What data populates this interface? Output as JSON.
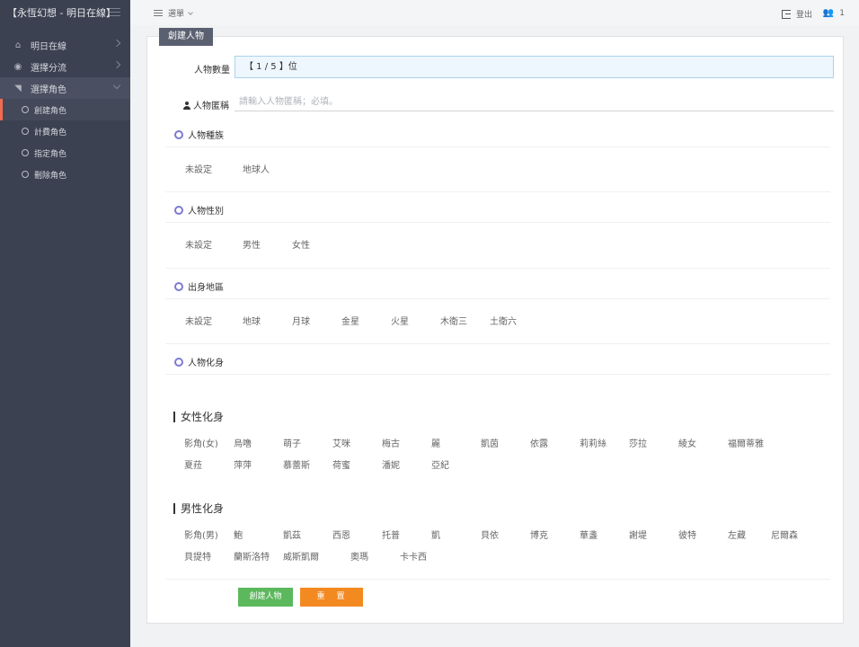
{
  "sidebar": {
    "brand": "【永恆幻想 - 明日在線】",
    "items": [
      {
        "label": "明日在線",
        "icon": "home-icon"
      },
      {
        "label": "選擇分流",
        "icon": "globe-icon"
      },
      {
        "label": "選擇角色",
        "icon": "triangle-icon"
      }
    ],
    "sub_items": [
      {
        "label": "創建角色"
      },
      {
        "label": "計費角色"
      },
      {
        "label": "指定角色"
      },
      {
        "label": "刪除角色"
      }
    ]
  },
  "topbar": {
    "menu_label": "選單",
    "logout_label": "登出",
    "users_count": "1"
  },
  "panel": {
    "tab": "創建人物",
    "quantity_label": "人物數量",
    "quantity_value": "【 1 / 5 】位",
    "name_label": "人物匿稱",
    "name_placeholder": "請輸入人物匿稱；必填。",
    "race": {
      "title": "人物種族",
      "options": [
        "未設定",
        "地球人"
      ]
    },
    "gender": {
      "title": "人物性別",
      "options": [
        "未設定",
        "男性",
        "女性"
      ]
    },
    "origin": {
      "title": "出身地區",
      "options": [
        "未設定",
        "地球",
        "月球",
        "金星",
        "火星",
        "木衛三",
        "土衛六"
      ]
    },
    "avatar": {
      "title": "人物化身"
    },
    "female": {
      "title": "女性化身",
      "row1": [
        "影角(女)",
        "烏噜",
        "萌子",
        "艾咪",
        "梅古",
        "麗",
        "凱茵",
        "依露",
        "莉莉絲",
        "莎拉",
        "綾女",
        "福爾蒂雅"
      ],
      "row2": [
        "夏菈",
        "萍萍",
        "慕蕾斯",
        "荷蜜",
        "潘妮",
        "亞紀"
      ]
    },
    "male": {
      "title": "男性化身",
      "row1": [
        "影角(男)",
        "鮑",
        "凱茲",
        "西恩",
        "托普",
        "凱",
        "貝依",
        "博克",
        "華盞",
        "謝堤",
        "彼特",
        "左藏",
        "尼爾森"
      ],
      "row2": [
        "貝提特",
        "蘭斯洛特",
        "威斯凱爾",
        "奧瑪",
        "卡卡西"
      ]
    },
    "create_button": "創建人物",
    "reset_button": "重　置"
  },
  "colors": {
    "sidebar_bg": "#3b4151",
    "accent_ring": "#7d79d2",
    "create_green": "#5cb85c",
    "reset_orange": "#f38a21",
    "active_marker": "#f06b4f"
  }
}
